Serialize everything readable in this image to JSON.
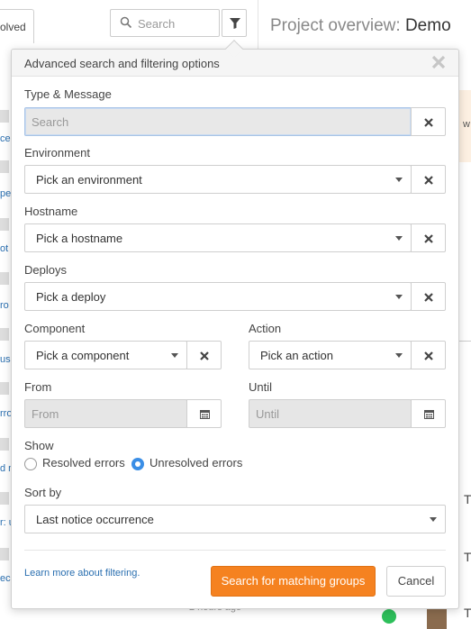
{
  "background": {
    "resolved_tab_label": "olved",
    "search": {
      "placeholder": "Search"
    },
    "project_title_prefix": "Project overview:",
    "project_name": "Demo",
    "left_strip_fragments": [
      "ce",
      "pe",
      "ot",
      "ro",
      "us",
      "rro",
      "d n",
      "r: u",
      "ec"
    ],
    "right_strip": {
      "orange_fragment": "w",
      "letters": [
        "T",
        "T",
        "T"
      ]
    },
    "bottom_time": "2 hours ago"
  },
  "modal": {
    "title": "Advanced search and filtering options",
    "fields": {
      "type_message": {
        "label": "Type & Message",
        "placeholder": "Search"
      },
      "environment": {
        "label": "Environment",
        "value": "Pick an environment"
      },
      "hostname": {
        "label": "Hostname",
        "value": "Pick a hostname"
      },
      "deploys": {
        "label": "Deploys",
        "value": "Pick a deploy"
      },
      "component": {
        "label": "Component",
        "value": "Pick a component"
      },
      "action": {
        "label": "Action",
        "value": "Pick an action"
      },
      "from": {
        "label": "From",
        "placeholder": "From"
      },
      "until": {
        "label": "Until",
        "placeholder": "Until"
      }
    },
    "show": {
      "label": "Show",
      "options": [
        {
          "label": "Resolved errors",
          "selected": false
        },
        {
          "label": "Unresolved errors",
          "selected": true
        }
      ]
    },
    "sort": {
      "label": "Sort by",
      "value": "Last notice occurrence"
    },
    "footer": {
      "learn_more": "Learn more about filtering.",
      "submit": "Search for matching groups",
      "cancel": "Cancel"
    }
  },
  "colors": {
    "accent": "#f58220",
    "link": "#2a6fb0",
    "radio_selected": "#3a8ee6"
  }
}
